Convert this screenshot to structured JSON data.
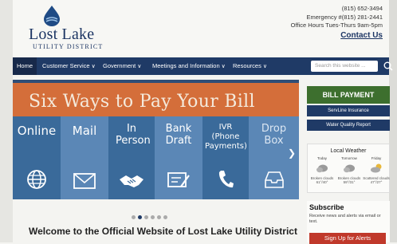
{
  "header": {
    "logo_title": "Lost Lake",
    "logo_subtitle": "UTILITY DISTRICT",
    "phone": "(815) 652-3494",
    "emergency": "Emergency #(815) 281-2441",
    "office_hours": "Office Hours Tues-Thurs 9am-5pm",
    "contact_link": "Contact Us"
  },
  "nav": {
    "items": [
      "Home",
      "Customer Service",
      "Government",
      "Meetings and Information",
      "Resources"
    ],
    "search_placeholder": "Search this website ..."
  },
  "carousel": {
    "title": "Six Ways to Pay Your Bill",
    "tiles": [
      {
        "label": "Online",
        "icon": "globe-icon",
        "color": "#3a6a9a"
      },
      {
        "label": "Mail",
        "icon": "envelope-icon",
        "color": "#5b87b6"
      },
      {
        "label": "In Person",
        "icon": "handshake-icon",
        "color": "#3a6a9a"
      },
      {
        "label": "Bank Draft",
        "icon": "check-icon",
        "color": "#5b87b6"
      },
      {
        "label": "IVR (Phone Payments)",
        "icon": "phone-icon",
        "color": "#3a6a9a"
      },
      {
        "label": "Drop Box",
        "icon": "dropbox-icon",
        "color": "#5b87b6"
      }
    ],
    "dots": 6,
    "active_dot": 1
  },
  "welcome": "Welcome to the Official Website of Lost Lake Utility District",
  "sidebar": {
    "bill_payment": "BILL PAYMENT",
    "servline": "ServLine Insurance",
    "water_quality": "Water Quality Report",
    "weather": {
      "title": "Local Weather",
      "days": [
        {
          "day": "Today",
          "desc": "Broken clouds 61°/40°"
        },
        {
          "day": "Tomorrow",
          "desc": "Broken clouds 59°/31°"
        },
        {
          "day": "Friday",
          "desc": "Scattered clouds 47°/27°"
        }
      ]
    },
    "subscribe": {
      "title": "Subscribe",
      "text": "Receive news and alerts via email or text.",
      "button": "Sign Up for Alerts"
    }
  },
  "colors": {
    "navy": "#1f3a66",
    "orange_banner": "#d46e3a",
    "green": "#3d6f2e",
    "red": "#c0392b"
  }
}
